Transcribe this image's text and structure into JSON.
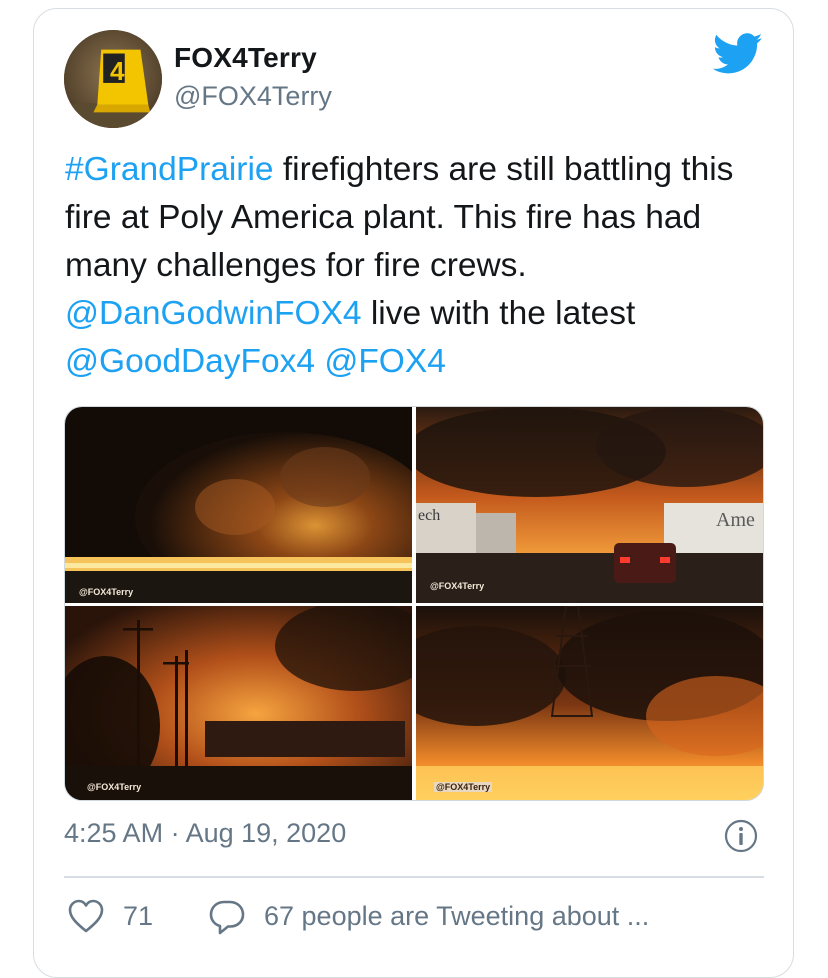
{
  "tweet": {
    "author": {
      "display_name": "FOX4Terry",
      "handle": "@FOX4Terry",
      "avatar_marker_number": "4"
    },
    "brand_icon": "twitter-bird-icon",
    "text_segments": [
      {
        "text": "#GrandPrairie",
        "type": "hashtag"
      },
      {
        "text": " firefighters are still battling this fire at Poly America plant. This fire has had many challenges for fire crews. ",
        "type": "text"
      },
      {
        "text": "@DanGodwinFOX4",
        "type": "mention"
      },
      {
        "text": " live with the latest ",
        "type": "text"
      },
      {
        "text": "@GoodDayFox4",
        "type": "mention"
      },
      {
        "text": " ",
        "type": "text"
      },
      {
        "text": "@FOX4",
        "type": "mention"
      }
    ],
    "media": [
      {
        "watermark": "@FOX4Terry"
      },
      {
        "watermark": "@FOX4Terry",
        "sign_text_left": "ech",
        "sign_text_right": "Ame"
      },
      {
        "watermark": "@FOX4Terry"
      },
      {
        "watermark": "@FOX4Terry"
      }
    ],
    "timestamp": "4:25 AM · Aug 19, 2020",
    "likes": "71",
    "tweeting_text": "67 people are Tweeting about ...",
    "colors": {
      "link": "#1da1f2",
      "secondary_text": "#657786",
      "border": "#d7dde2"
    }
  }
}
